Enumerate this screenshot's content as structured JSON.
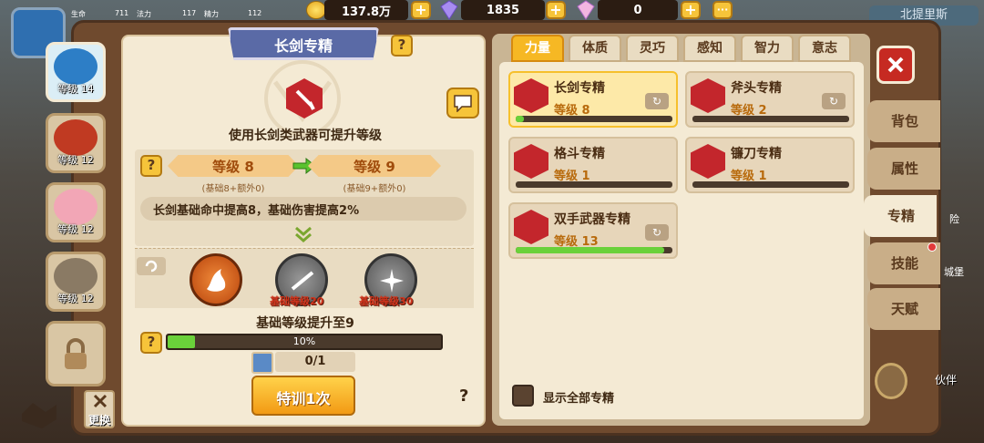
{
  "top": {
    "stats": [
      {
        "label": "生命",
        "value": "711"
      },
      {
        "label": "法力",
        "value": "117"
      },
      {
        "label": "精力",
        "value": "112"
      }
    ],
    "gold": "137.8万",
    "diamond": "1835",
    "rainbow_gem": "0",
    "top_right_text": "北提里斯",
    "plus_label": "+",
    "more_label": "···"
  },
  "characters": [
    {
      "level": "等级 14"
    },
    {
      "level": "等级 12"
    },
    {
      "level": "等级 12"
    },
    {
      "level": "等级 12"
    }
  ],
  "bottom_left": {
    "swap_label": "更换"
  },
  "left_panel": {
    "title": "长剑专精",
    "help": "?",
    "description": "使用长剑类武器可提升等级",
    "level_from": "等级 8",
    "level_to": "等级 9",
    "level_from_detail": "(基础8+额外0)",
    "level_to_detail": "(基础9+额外0)",
    "effect": "长剑基础命中提高8，基础伤害提高2%",
    "skill_req_1": "基础等级20",
    "skill_req_2": "基础等级30",
    "upgrade_text": "基础等级提升至9",
    "progress_label": "10%",
    "progress": 0.1,
    "item_count": "0/1",
    "train_button": "特训1次",
    "question": "?"
  },
  "tabs": [
    "力量",
    "体质",
    "灵巧",
    "感知",
    "智力",
    "意志"
  ],
  "active_tab": 0,
  "skills": [
    {
      "name": "长剑专精",
      "level": "等级 8",
      "progress": 0.05,
      "selected": true
    },
    {
      "name": "斧头专精",
      "level": "等级 2",
      "progress": 0,
      "selected": false
    },
    {
      "name": "格斗专精",
      "level": "等级 1",
      "progress": 0,
      "selected": false
    },
    {
      "name": "镰刀专精",
      "level": "等级 1",
      "progress": 0,
      "selected": false
    },
    {
      "name": "双手武器专精",
      "level": "等级 13",
      "progress": 0.95,
      "selected": false
    }
  ],
  "show_all_label": "显示全部专精",
  "side_tabs": [
    "背包",
    "属性",
    "专精",
    "技能",
    "天赋"
  ],
  "side_active": 2,
  "bg_labels": {
    "r1": "险",
    "r2": "城堡",
    "r3": "伴"
  },
  "partner_label": "伙伴",
  "colors": {
    "accent": "#f6b824",
    "level_text": "#b86a0c",
    "progress_green": "#6ad13a",
    "skill_red": "#c3262c"
  }
}
